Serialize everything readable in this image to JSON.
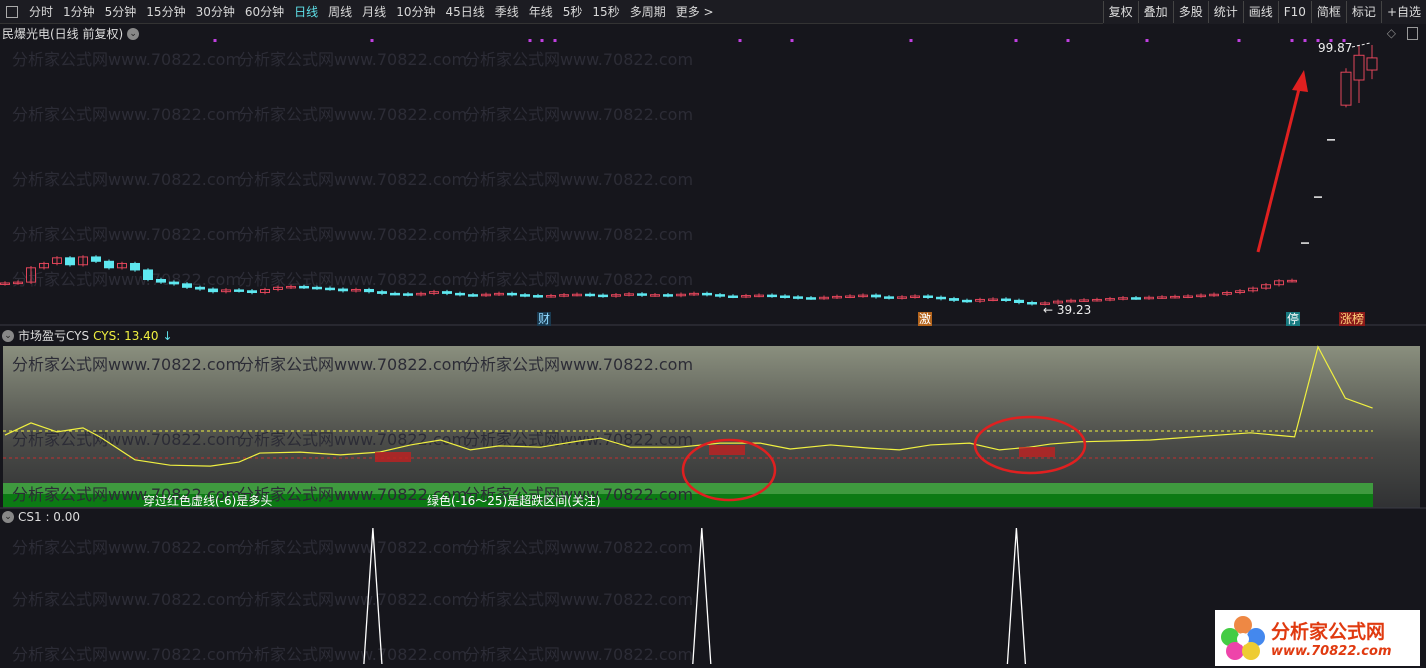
{
  "toolbar": {
    "periods": [
      "分时",
      "1分钟",
      "5分钟",
      "15分钟",
      "30分钟",
      "60分钟",
      "日线",
      "周线",
      "月线",
      "10分钟",
      "45日线",
      "季线",
      "年线",
      "5秒",
      "15秒",
      "多周期",
      "更多 >"
    ],
    "active": "日线",
    "right": [
      "复权",
      "叠加",
      "多股",
      "统计",
      "画线",
      "F10",
      "简框",
      "标记",
      "+自选"
    ]
  },
  "main": {
    "title": "民爆光电(日线 前复权)",
    "high_label": "99.87",
    "low_label": "39.23",
    "signals": [
      {
        "text": "财",
        "bg": "#1a3a50",
        "color": "#8fd8ff"
      },
      {
        "text": "激",
        "bg": "#b5651d",
        "color": "#fff"
      },
      {
        "text": "停",
        "bg": "#177a80",
        "color": "#fff"
      },
      {
        "text": "涨榜",
        "bg": "#8b1a1a",
        "color": "#ffd27a"
      }
    ]
  },
  "cys": {
    "title": "市场盈亏CYS",
    "value_label": "CYS: 13.40",
    "legend1": "穿过红色虚线(-6)是多头",
    "legend2": "绿色(-16～25)是超跌区间(关注)"
  },
  "cs1": {
    "title": "CS1 : 0.00"
  },
  "watermark": "分析家公式网www.70822.com",
  "logo": {
    "name": "分析家公式网",
    "url": "www.70822.com"
  },
  "colors": {
    "up": "#e0455a",
    "down": "#5ee8f0",
    "accent": "#5ee0e8",
    "line": "#f0f040"
  },
  "chart_data": {
    "type": "candlestick",
    "closes": [
      45.0,
      45.2,
      48.5,
      49.5,
      50.8,
      49.2,
      51.0,
      50.0,
      48.5,
      49.5,
      48.0,
      45.8,
      45.2,
      44.8,
      44.0,
      43.6,
      43.0,
      43.4,
      43.2,
      42.8,
      43.5,
      44.0,
      44.2,
      44.0,
      43.8,
      43.6,
      43.2,
      43.5,
      43.0,
      42.6,
      42.5,
      42.3,
      42.6,
      43.0,
      42.6,
      42.3,
      42.2,
      42.4,
      42.6,
      42.3,
      42.1,
      42.0,
      42.1,
      42.3,
      42.4,
      42.2,
      42.0,
      42.3,
      42.5,
      42.2,
      42.3,
      42.1,
      42.4,
      42.6,
      42.3,
      42.0,
      41.9,
      42.1,
      42.2,
      42.0,
      41.8,
      41.6,
      41.5,
      41.7,
      41.9,
      42.0,
      42.2,
      41.8,
      41.6,
      41.8,
      42.0,
      41.7,
      41.4,
      41.0,
      40.8,
      41.2,
      41.3,
      41.0,
      40.5,
      40.2,
      40.4,
      40.8,
      41.0,
      41.1,
      41.2,
      41.4,
      41.6,
      41.5,
      41.7,
      41.8,
      41.9,
      42.0,
      42.2,
      42.4,
      42.8,
      43.2,
      43.8,
      44.6,
      45.5,
      45.6
    ],
    "limit_up": [
      54.2,
      64.8,
      78.0
    ],
    "last_candles": [
      [
        86.0,
        93.6,
        94.5,
        85.5
      ],
      [
        91.8,
        97.5,
        99.87,
        86.5
      ],
      [
        94.1,
        96.9,
        99.87,
        92.0
      ]
    ],
    "price_range": [
      39.23,
      99.87
    ],
    "cys_points": [
      [
        0,
        -0.9
      ],
      [
        2,
        1.8
      ],
      [
        4,
        -0.2
      ],
      [
        6,
        0.7
      ],
      [
        7.3,
        -1.3
      ],
      [
        10,
        -6.4
      ],
      [
        12.7,
        -7.6
      ],
      [
        15.8,
        -7.8
      ],
      [
        18,
        -6.9
      ],
      [
        19.6,
        -4.9
      ],
      [
        22.7,
        -4.7
      ],
      [
        25.8,
        -5.3
      ],
      [
        28.8,
        -4.7
      ],
      [
        31.2,
        -3.1
      ],
      [
        33.5,
        -2.0
      ],
      [
        35.8,
        -4.2
      ],
      [
        38,
        -3.3
      ],
      [
        41.2,
        -3.6
      ],
      [
        44.2,
        -2.2
      ],
      [
        45.8,
        -1.6
      ],
      [
        48.1,
        -3.6
      ],
      [
        51.9,
        -3.6
      ],
      [
        55,
        -2.7
      ],
      [
        58.1,
        -2.7
      ],
      [
        60.4,
        -4.0
      ],
      [
        63.5,
        -3.1
      ],
      [
        66.5,
        -3.8
      ],
      [
        68.8,
        -4.2
      ],
      [
        71.2,
        -3.1
      ],
      [
        74.2,
        -2.7
      ],
      [
        76.5,
        -4.2
      ],
      [
        78.8,
        -3.6
      ],
      [
        80.4,
        -2.9
      ],
      [
        82.7,
        -2.4
      ],
      [
        88.1,
        -2.0
      ],
      [
        95.8,
        -0.4
      ],
      [
        99.2,
        -1.3
      ],
      [
        101,
        18.7
      ],
      [
        103.1,
        7.3
      ],
      [
        105.2,
        5.1
      ]
    ],
    "cys_levels": {
      "yellow": 0,
      "red": -6
    },
    "cs1_spikes": [
      28.3,
      53.6,
      77.8
    ]
  }
}
